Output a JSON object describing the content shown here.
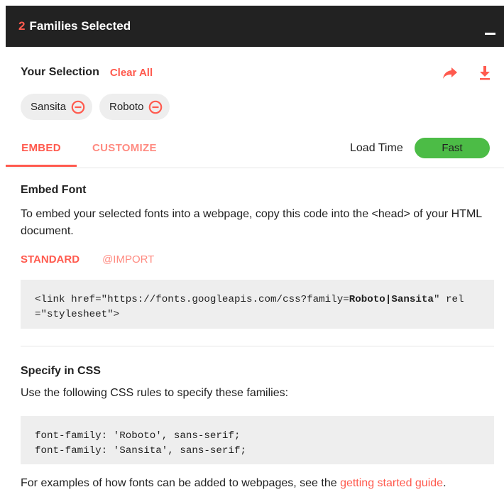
{
  "header": {
    "count": "2",
    "title": "Families Selected",
    "minimize_icon": "minimize-icon"
  },
  "selection": {
    "label": "Your Selection",
    "clear_all": "Clear All",
    "share_icon": "share-icon",
    "download_icon": "download-icon",
    "chips": [
      {
        "name": "Sansita",
        "remove_icon": "remove-circle-icon"
      },
      {
        "name": "Roboto",
        "remove_icon": "remove-circle-icon"
      }
    ]
  },
  "tabs": {
    "embed": "EMBED",
    "customize": "CUSTOMIZE",
    "active": "EMBED",
    "load_time_label": "Load Time",
    "load_time_value": "Fast"
  },
  "embed": {
    "title": "Embed Font",
    "description": "To embed your selected fonts into a webpage, copy this code into the <head> of your HTML document.",
    "subtabs": [
      "STANDARD",
      "@IMPORT"
    ],
    "active_subtab": "STANDARD",
    "code_line1_start": "<link href=\"https://fonts.googleapis.com/css?family=",
    "code_family1": "Roboto",
    "code_sep": "|",
    "code_family2": "Sansita",
    "code_line1_end": "\" rel",
    "code_line2": "=\"stylesheet\">"
  },
  "css": {
    "title": "Specify in CSS",
    "description": "Use the following CSS rules to specify these families:",
    "lines": [
      "font-family: 'Roboto', sans-serif;",
      "font-family: 'Sansita', sans-serif;"
    ]
  },
  "footer": {
    "text": "For examples of how fonts can be added to webpages, see the ",
    "link": "getting started guide",
    "end": "."
  },
  "colors": {
    "accent": "#ff5a4e",
    "header_bg": "#222222",
    "fast": "#4cbc46",
    "chip_bg": "#eeeeee"
  }
}
